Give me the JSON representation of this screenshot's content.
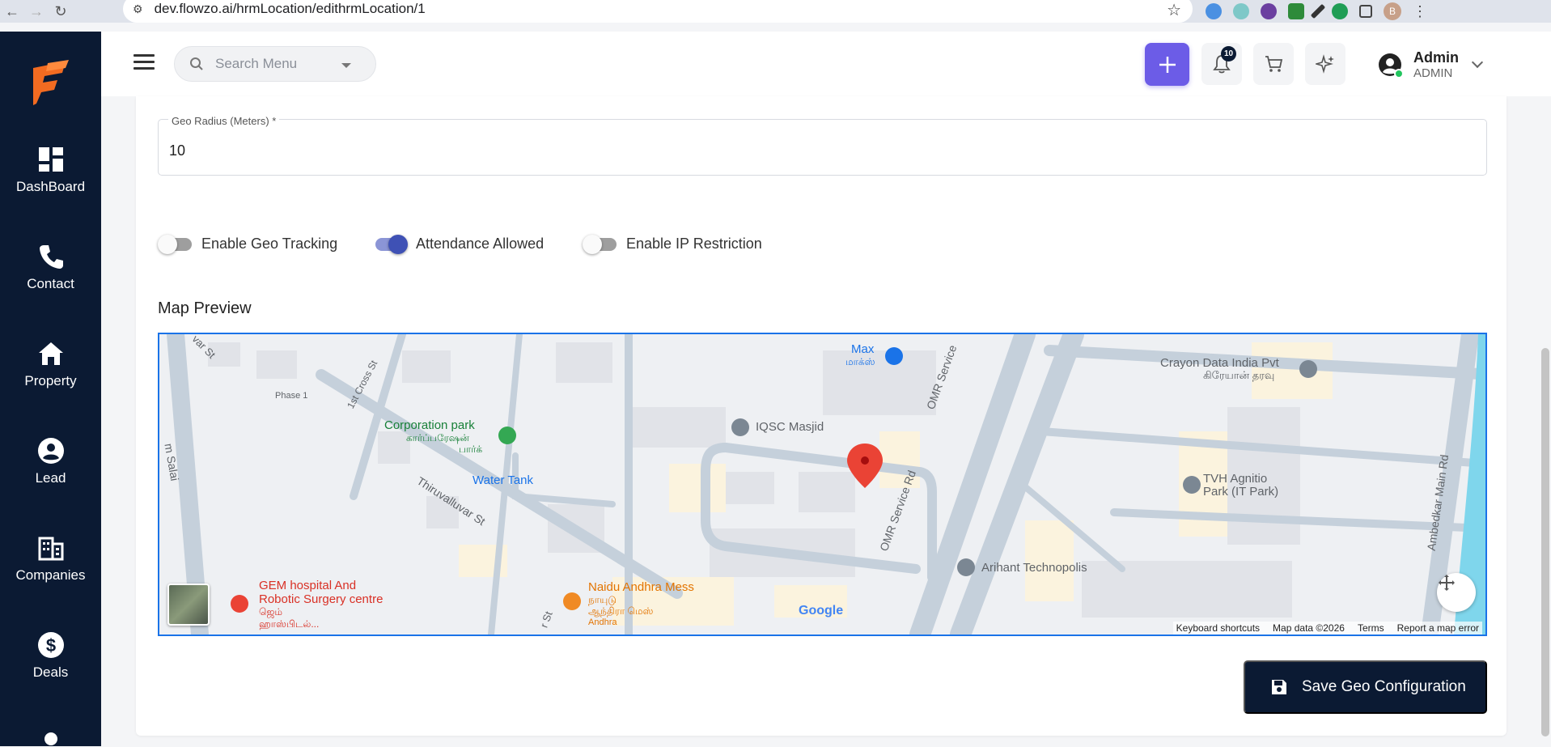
{
  "browser": {
    "url": "dev.flowzo.ai/hrmLocation/edithrmLocation/1",
    "profile_initial": "B"
  },
  "sidebar": {
    "items": [
      {
        "label": "DashBoard",
        "icon": "dashboard-icon"
      },
      {
        "label": "Contact",
        "icon": "phone-icon"
      },
      {
        "label": "Property",
        "icon": "home-icon"
      },
      {
        "label": "Lead",
        "icon": "person-icon"
      },
      {
        "label": "Companies",
        "icon": "companies-icon"
      },
      {
        "label": "Deals",
        "icon": "dollar-icon"
      }
    ]
  },
  "header": {
    "search_placeholder": "Search Menu",
    "notification_count": "10",
    "user_name": "Admin",
    "user_role": "ADMIN"
  },
  "form": {
    "geo_radius_label": "Geo Radius (Meters) *",
    "geo_radius_value": "10",
    "toggles": [
      {
        "label": "Enable Geo Tracking",
        "on": false
      },
      {
        "label": "Attendance Allowed",
        "on": true
      },
      {
        "label": "Enable IP Restriction",
        "on": false
      }
    ],
    "map_title": "Map Preview",
    "save_label": "Save Geo Configuration"
  },
  "map": {
    "labels": {
      "max": "Max",
      "max_ta": "மாக்ஸ்",
      "crayon": "Crayon Data India Pvt",
      "crayon_ta": "கிரேயான் தரவு",
      "iqsc": "IQSC Masjid",
      "corporation": "Corporation park",
      "corporation_ta1": "கார்ப்பரேஷன்",
      "corporation_ta2": "பார்க்",
      "phase1": "Phase 1",
      "cross": "1st Cross St",
      "water_tank": "Water Tank",
      "thiruvalluvar": "Thiruvalluvar St",
      "omr1": "OMR Service Rd",
      "omr2": "OMR Service",
      "ambedkar": "Ambedkar Main Rd",
      "tvh1": "TVH Agnitio",
      "tvh2": "Park (IT Park)",
      "arihant": "Arihant Technopolis",
      "gem1": "GEM hospital And",
      "gem2": "Robotic Surgery centre",
      "gem_ta1": "ஜெம்",
      "gem_ta2": "ஹாஸ்பிடல்...",
      "naidu1": "Naidu Andhra Mess",
      "naidu_ta1": "நாயுடு",
      "naidu_ta2": "ஆந்திரா மெஸ்",
      "naidu_ta3": "Andhra",
      "salai": "m Salai",
      "var_st": "var St",
      "r_st": "r St",
      "google": "Google"
    },
    "footer": [
      "Keyboard shortcuts",
      "Map data ©2026",
      "Terms",
      "Report a map error"
    ]
  }
}
